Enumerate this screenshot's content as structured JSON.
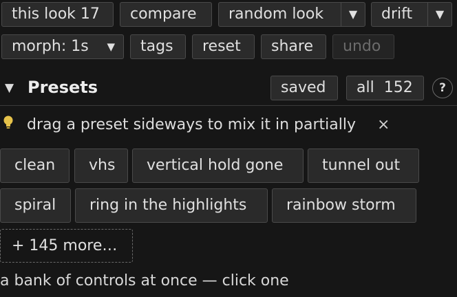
{
  "toolbar": {
    "this_look": "this look 17",
    "compare": "compare",
    "random_look": "random look",
    "random_look_menu": "▼",
    "drift": "drift",
    "drift_menu": "▼",
    "morph": "morph: 1s",
    "morph_caret": "▼",
    "tags": "tags",
    "reset": "reset",
    "share": "share",
    "undo": "undo"
  },
  "presets": {
    "collapse_glyph": "▼",
    "title": "Presets",
    "saved": "saved",
    "all_label": "all",
    "all_count": "152",
    "help": "?",
    "hint": "drag a preset sideways to mix it in partially",
    "hint_icon": "lightbulb-icon",
    "hint_close": "×",
    "items": [
      "clean",
      "vhs",
      "vertical hold gone",
      "tunnel out",
      "spiral",
      "ring in the highlights",
      "rainbow storm"
    ],
    "more": "+ 145 more…"
  },
  "footer": {
    "text": "a bank of controls at once — click one"
  },
  "colors": {
    "background": "#161616",
    "button_bg": "#2b2b2b",
    "border": "#4a4a4a",
    "bulb": "#e6c24a"
  }
}
